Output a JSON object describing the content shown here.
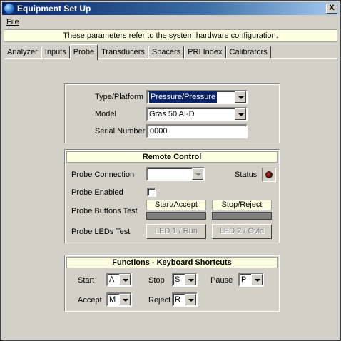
{
  "window": {
    "title": "Equipment Set Up",
    "close_glyph": "X"
  },
  "menu": {
    "file": "File"
  },
  "info_banner": "These parameters refer to the system hardware configuration.",
  "tabs": [
    "Analyzer",
    "Inputs",
    "Probe",
    "Transducers",
    "Spacers",
    "PRI Index",
    "Calibrators"
  ],
  "active_tab": "Probe",
  "probe_group": {
    "type_label": "Type/Platform",
    "type_value": "Pressure/Pressure",
    "model_label": "Model",
    "model_value": "Gras  50 AI-D",
    "serial_label": "Serial Number",
    "serial_value": "0000"
  },
  "remote_control": {
    "header": "Remote Control",
    "probe_connection_label": "Probe Connection",
    "probe_connection_value": "",
    "status_label": "Status",
    "probe_enabled_label": "Probe Enabled",
    "probe_enabled_checked": false,
    "buttons_test_label": "Probe Buttons Test",
    "start_accept_label": "Start/Accept",
    "stop_reject_label": "Stop/Reject",
    "leds_test_label": "Probe LEDs Test",
    "led1_button": "LED 1 / Run",
    "led2_button": "LED 2 / Ovld"
  },
  "shortcuts": {
    "header": "Functions - Keyboard Shortcuts",
    "start_label": "Start",
    "start_value": "A",
    "stop_label": "Stop",
    "stop_value": "S",
    "pause_label": "Pause",
    "pause_value": "P",
    "accept_label": "Accept",
    "accept_value": "M",
    "reject_label": "Reject",
    "reject_value": "R"
  },
  "colors": {
    "titlebar_start": "#0a246a",
    "banner_bg": "#ffffe1",
    "window_bg": "#d4d0c8",
    "status_led": "#6a0000"
  }
}
